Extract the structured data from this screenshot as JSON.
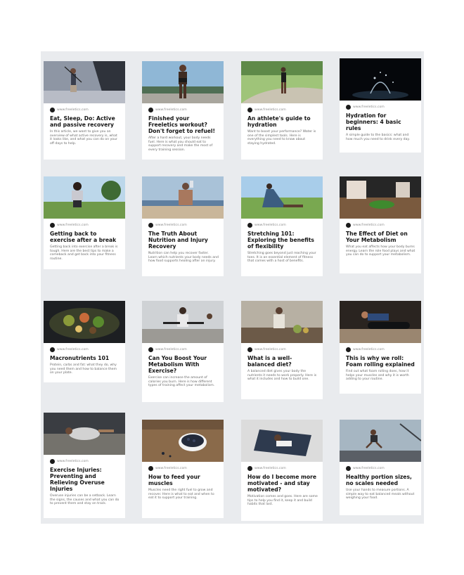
{
  "source_label": "www.freeletics.com",
  "articles": [
    {
      "title": "Eat, Sleep, Do: Active and passive recovery",
      "description": "In this article, we want to give you an overview of what active recovery is, what it looks like, and what you can do on your off days to help."
    },
    {
      "title": "Finished your Freeletics workout? Don't forget to refuel!",
      "description": "After a hard workout, your body needs fuel. Here is what you should eat to support recovery and make the most of every training session."
    },
    {
      "title": "An athlete's guide to hydration",
      "description": "Want to boost your performance? Water is one of the simplest tools. Here is everything you need to know about staying hydrated."
    },
    {
      "title": "Hydration for beginners: 4 basic rules",
      "description": "A simple guide to the basics: what and how much you need to drink every day."
    },
    {
      "title": "Getting back to exercise after a break",
      "description": "Getting back into exercise after a break is tough. Here are the best tips to make a comeback and get back into your fitness routine."
    },
    {
      "title": "The Truth About Nutrition and Injury Recovery",
      "description": "Nutrition can help you recover faster. Learn which nutrients your body needs and how food supports healing after an injury."
    },
    {
      "title": "Stretching 101: Exploring the benefits of flexibility",
      "description": "Stretching goes beyond just reaching your toes. It is an essential element of fitness that comes with a host of benefits."
    },
    {
      "title": "The Effect of Diet on Your Metabolism",
      "description": "What you eat affects how your body burns energy. Learn the role food plays and what you can do to support your metabolism."
    },
    {
      "title": "Macronutrients 101",
      "description": "Protein, carbs and fat: what they do, why you need them and how to balance them on your plate."
    },
    {
      "title": "Can You Boost Your Metabolism With Exercise?",
      "description": "Exercise can increase the amount of calories you burn. Here is how different types of training affect your metabolism."
    },
    {
      "title": "What is a well-balanced diet?",
      "description": "A balanced diet gives your body the nutrients it needs to work properly. Here is what it includes and how to build one."
    },
    {
      "title": "This is why we roll: Foam rolling explained",
      "description": "Find out what foam rolling does, how it helps your muscles and why it is worth adding to your routine."
    },
    {
      "title": "Exercise Injuries: Preventing and Relieving Overuse Injuries",
      "description": "Overuse injuries can be a setback. Learn the signs, the causes and what you can do to prevent them and stay on track."
    },
    {
      "title": "How to feed your muscles",
      "description": "Muscles need the right fuel to grow and recover. Here is what to eat and when to eat it to support your training."
    },
    {
      "title": "How do I become more motivated - and stay motivated?",
      "description": "Motivation comes and goes. Here are some tips to help you find it, keep it and build habits that last."
    },
    {
      "title": "Healthy portion sizes, no scales needed",
      "description": "Use your hands to measure portions. A simple way to eat balanced meals without weighing your food."
    }
  ]
}
